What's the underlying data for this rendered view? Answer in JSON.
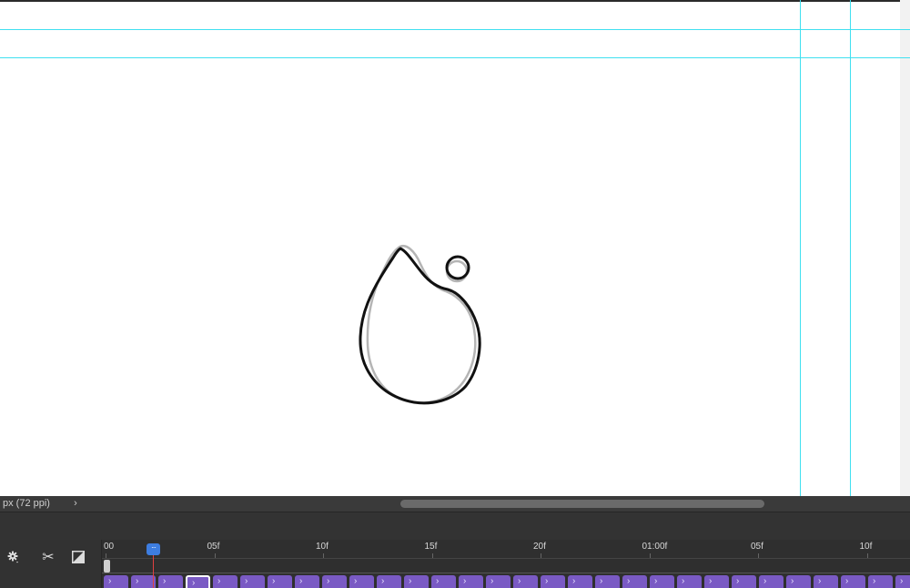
{
  "status_bar": {
    "doc_info": "px (72 ppi)",
    "arrow_icon": "chevron-right-icon"
  },
  "timeline": {
    "ruler_labels": [
      "00",
      "05f",
      "10f",
      "15f",
      "20f",
      "01:00f",
      "05f",
      "10f"
    ],
    "current_frame": 2,
    "frame_count": 30,
    "selected_frame": 3,
    "controls": [
      "gear-icon",
      "scissors-icon",
      "transition-icon"
    ]
  },
  "colors": {
    "guide": "#3fe0f0",
    "frame": "#7a5ac4",
    "playhead": "#3d7de0",
    "playhead_line": "#e04040"
  }
}
